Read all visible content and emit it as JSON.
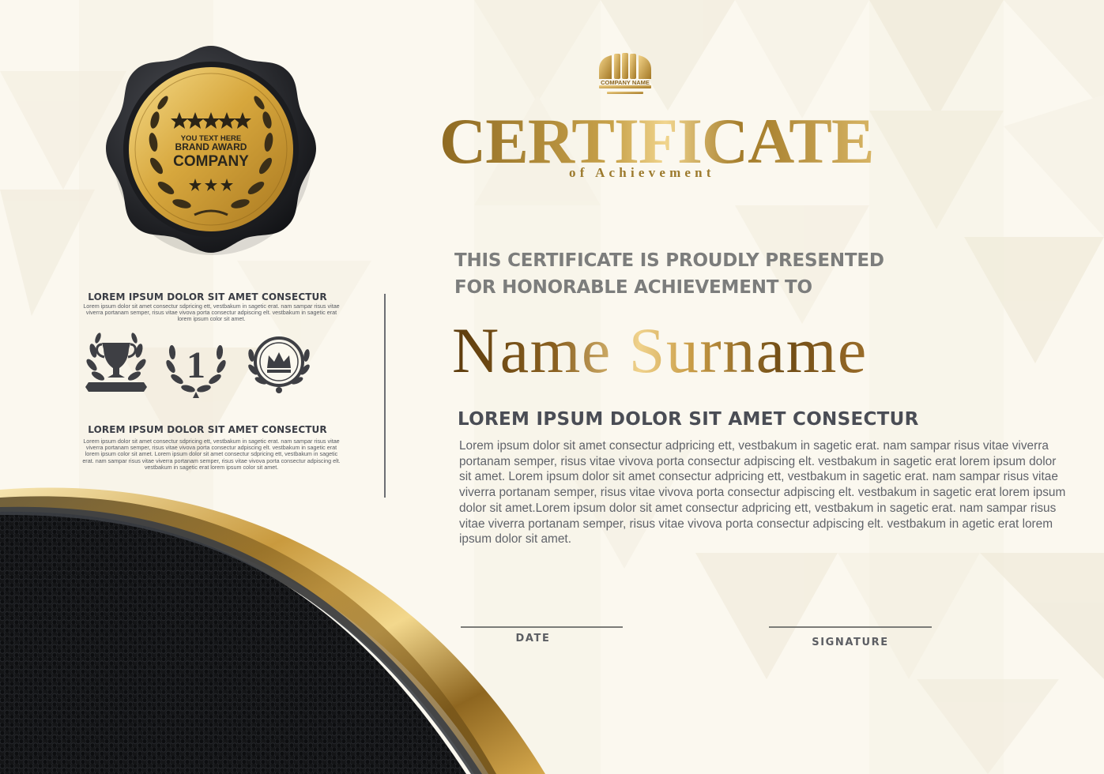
{
  "seal": {
    "line1": "YOU TEXT HERE",
    "line2": "BRAND AWARD",
    "line3": "COMPANY"
  },
  "logo": {
    "label": "COMPANY NAME"
  },
  "left_panel": {
    "heading_top": "LOREM IPSUM DOLOR SIT AMET CONSECTUR",
    "text_top": "Lorem ipsum dolor sit amet consectur sdpricing ett, vestbakum in sagetic erat. nam sampar risus vitae viverra portanam semper, risus vitae vivova porta consectur adpiscing elt. vestbakum in sagetic erat lorem ipsum color sit amet.",
    "emblems": [
      {
        "icon": "trophy-icon"
      },
      {
        "icon": "number-one-icon",
        "text": "1"
      },
      {
        "icon": "crown-icon"
      }
    ],
    "heading_bottom": "LOREM IPSUM DOLOR SIT AMET CONSECTUR",
    "text_bottom": "Lorem ipsum dolor sit amet consectur sdpricing ett, vestbakum in sagetic erat. nam sampar risus vitae viverra portanam semper, risus vitae vivova porta consectur adpiscing elt. vestbakum in sagetic erat lorem ipsum color sit amet. Lorem ipsum dolor sit amet consectur sdpricing ett, vestbakum in sagetic erat. nam sampar risus vitae viverra portanam semper, risus vitae vivova porta consectur adpiscing elt. vestbakum in sagetic erat lorem ipsum color sit amet."
  },
  "certificate": {
    "title": "CERTIFICATE",
    "subtitle": "of Achievement",
    "presented_line1": "THIS CERTIFICATE IS PROUDLY PRESENTED",
    "presented_line2": "FOR HONORABLE ACHIEVEMENT TO",
    "recipient": "Name Surname",
    "body_heading": "LOREM IPSUM DOLOR SIT AMET CONSECTUR",
    "body_text": "Lorem ipsum dolor sit amet consectur adpricing ett, vestbakum in sagetic erat. nam sampar risus vitae viverra portanam semper, risus vitae vivova porta consectur adpiscing elt. vestbakum in sagetic erat lorem ipsum dolor sit amet. Lorem ipsum dolor sit amet consectur adpricing ett, vestbakum in sagetic erat. nam sampar risus vitae viverra portanam semper, risus vitae vivova porta consectur adpiscing elt. vestbakum in sagetic erat lorem ipsum dolor sit amet.Lorem ipsum dolor sit amet consectur adpricing ett, vestbakum in sagetic erat. nam sampar risus vitae viverra portanam semper, risus vitae vivova porta consectur adpiscing elt. vestbakum in agetic erat lorem ipsum dolor sit amet.",
    "date_label": "DATE",
    "signature_label": "SIGNATURE"
  },
  "colors": {
    "background": "#fbf8ef",
    "gold": "#c9a14a",
    "dark_gold": "#7a5517",
    "black_panel": "#111214",
    "text_gray": "#60636a"
  }
}
